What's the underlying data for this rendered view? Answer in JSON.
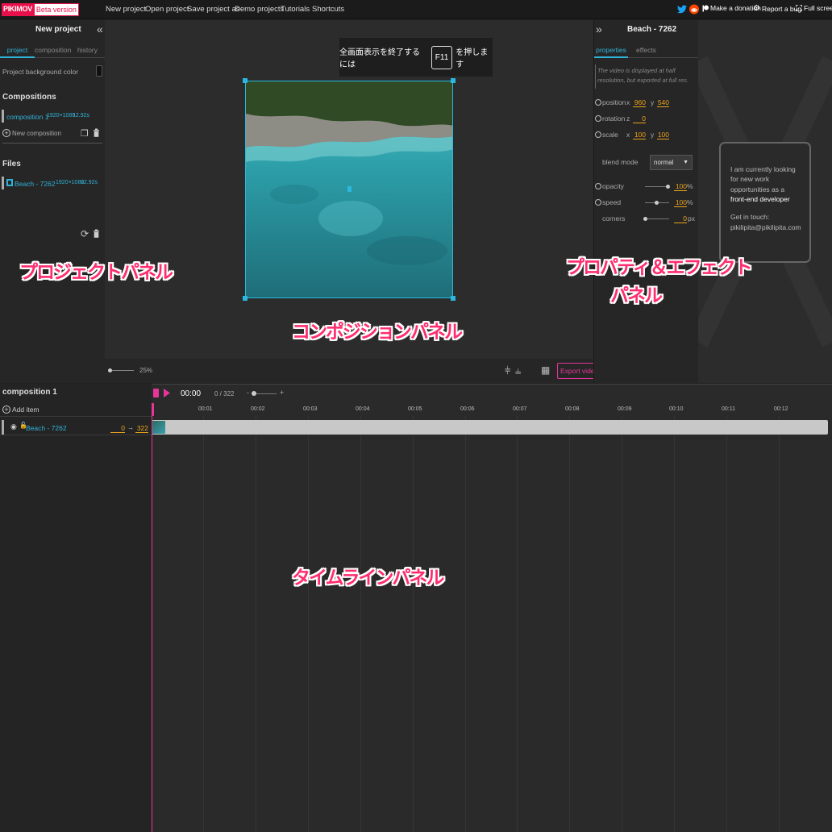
{
  "app": {
    "logo_name": "PIKIMOV",
    "beta_label": "Beta version"
  },
  "menu": {
    "items": [
      "New project",
      "Open project",
      "Save project as",
      "Demo projects",
      "Tutorials",
      "Shortcuts"
    ],
    "right": {
      "donation": "Make a donation",
      "report_bug": "Report a bug",
      "full_screen": "Full screen"
    },
    "icons": [
      "twitter-icon",
      "reddit-icon",
      "patreon-icon",
      "gear-icon",
      "fullscreen-icon"
    ]
  },
  "project_panel": {
    "title": "New project",
    "collapse_icon": "«",
    "tabs": [
      "project",
      "composition",
      "history"
    ],
    "bg_color_label": "Project background color",
    "compositions_title": "Compositions",
    "composition": {
      "name": "composition 1",
      "res": "1920×1080",
      "duration": "12.92s"
    },
    "new_composition": "New composition",
    "files_title": "Files",
    "file": {
      "name": "Beach - 7262",
      "res": "1920×1080",
      "duration": "12.92s"
    }
  },
  "composition_panel": {
    "toast_prefix": "全画面表示を終了するには",
    "toast_key": "F11",
    "toast_suffix": "を押します",
    "zoom": "25%",
    "export_label": "Export video"
  },
  "properties_panel": {
    "expand_icon": "»",
    "title": "Beach - 7262",
    "tabs": [
      "properties",
      "effects"
    ],
    "note": "The video is displayed at half resolution, but exported at full res.",
    "position": {
      "label": "position",
      "x_label": "x",
      "x": "960",
      "y_label": "y",
      "y": "540"
    },
    "rotation": {
      "label": "rotation",
      "z_label": "z",
      "z": "0"
    },
    "scale": {
      "label": "scale",
      "x_label": "x",
      "x": "100",
      "y_label": "y",
      "y": "100"
    },
    "blend_label": "blend mode",
    "blend_value": "normal",
    "opacity": {
      "label": "opacity",
      "value": "100",
      "unit": "%",
      "level": 1.0
    },
    "speed": {
      "label": "speed",
      "value": "100",
      "unit": "%",
      "level": 0.5
    },
    "corners": {
      "label": "corners",
      "value": "0",
      "unit": "px",
      "level": 0.0
    }
  },
  "promo": {
    "line1": "I am currently looking for new work opportunities as a",
    "highlight": "front-end developer",
    "contact_label": "Get in touch:",
    "email": "pikilipita@pikilipita.com"
  },
  "timeline": {
    "composition_name": "composition 1",
    "add_item": "Add item",
    "time": "00:00",
    "frame": "0 / 322",
    "zoom_minus": "-",
    "zoom_plus": "+",
    "ticks": [
      "00:01",
      "00:02",
      "00:03",
      "00:04",
      "00:05",
      "00:06",
      "00:07",
      "00:08",
      "00:09",
      "00:10",
      "00:11",
      "00:12"
    ],
    "layer": {
      "name": "Beach - 7262",
      "start": "0",
      "arrow": "→",
      "end": "322"
    }
  },
  "annotations": {
    "project": "プロジェクトパネル",
    "props_line1": "プロパティ＆エフェクト",
    "props_line2": "パネル",
    "composition": "コンポジションパネル",
    "timeline": "タイムラインパネル"
  },
  "colors": {
    "accent": "#2fb3d9",
    "brand": "#e8104a",
    "value": "#e8a21c",
    "playhead": "#e8359a",
    "annotation": "#ff2d6e"
  }
}
